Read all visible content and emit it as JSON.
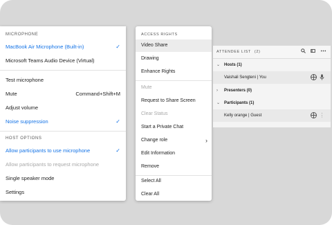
{
  "mic_menu": {
    "header_microphone": "MICROPHONE",
    "items": [
      {
        "label": "MacBook Air Microphone (Built-in)",
        "checked": true
      },
      {
        "label": "Microsoft Teams Audio Device (Virtual)"
      },
      {
        "label": "Test microphone"
      },
      {
        "label": "Mute",
        "shortcut": "Command+Shift+M"
      },
      {
        "label": "Adjust volume"
      },
      {
        "label": "Noise suppression",
        "checked": true
      }
    ],
    "header_host": "HOST OPTIONS",
    "host_items": [
      {
        "label": "Allow participants to use microphone",
        "checked": true
      },
      {
        "label": "Allow participants to request microphone",
        "disabled": true
      },
      {
        "label": "Single speaker mode"
      },
      {
        "label": "Settings"
      }
    ],
    "check_glyph": "✓"
  },
  "rights_menu": {
    "header": "ACCESS RIGHTS",
    "items": [
      {
        "label": "Video Share"
      },
      {
        "label": "Drawing"
      },
      {
        "label": "Enhance Rights"
      },
      {
        "label": "Mute",
        "disabled": true
      },
      {
        "label": "Request to Share Screen"
      },
      {
        "label": "Clear Status",
        "disabled": true
      },
      {
        "label": "Start a Private Chat"
      },
      {
        "label": "Change role",
        "submenu": true
      },
      {
        "label": "Edit Information"
      },
      {
        "label": "Remove"
      },
      {
        "label": "Select All"
      },
      {
        "label": "Clear All"
      }
    ],
    "chevron": "›"
  },
  "attendee_list": {
    "title": "ATTENDEE LIST",
    "count": "(2)",
    "groups": {
      "hosts": "Hosts (1)",
      "presenters": "Presenters (0)",
      "participants": "Participants (1)"
    },
    "host_person": "Vaishali Sengteni  | You",
    "participant_person": "Kelly orange  | Guest"
  },
  "colors": {
    "accent": "#1473e6",
    "disabled": "#a8a8a8",
    "background": "#d8d8d8"
  }
}
